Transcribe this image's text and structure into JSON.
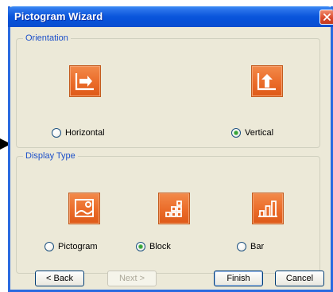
{
  "window": {
    "title": "Pictogram Wizard"
  },
  "icons": {
    "window_close": "close-icon",
    "pointer": "arrow-pointer-icon"
  },
  "colors": {
    "title_bar": "#0b56dc",
    "group_title": "#1b4fc9",
    "icon_tile": "#eb6d2b",
    "radio_selected": "#36a336"
  },
  "orientation": {
    "title": "Orientation",
    "options": [
      {
        "label": "Horizontal",
        "icon": "horizontal-arrow-icon",
        "selected": false
      },
      {
        "label": "Vertical",
        "icon": "vertical-arrow-icon",
        "selected": true
      }
    ]
  },
  "display_type": {
    "title": "Display Type",
    "options": [
      {
        "label": "Pictogram",
        "icon": "picture-icon",
        "selected": false
      },
      {
        "label": "Block",
        "icon": "block-icon",
        "selected": true
      },
      {
        "label": "Bar",
        "icon": "bar-chart-icon",
        "selected": false
      }
    ]
  },
  "buttons": {
    "back": "< Back",
    "next": "Next >",
    "finish": "Finish",
    "cancel": "Cancel"
  }
}
